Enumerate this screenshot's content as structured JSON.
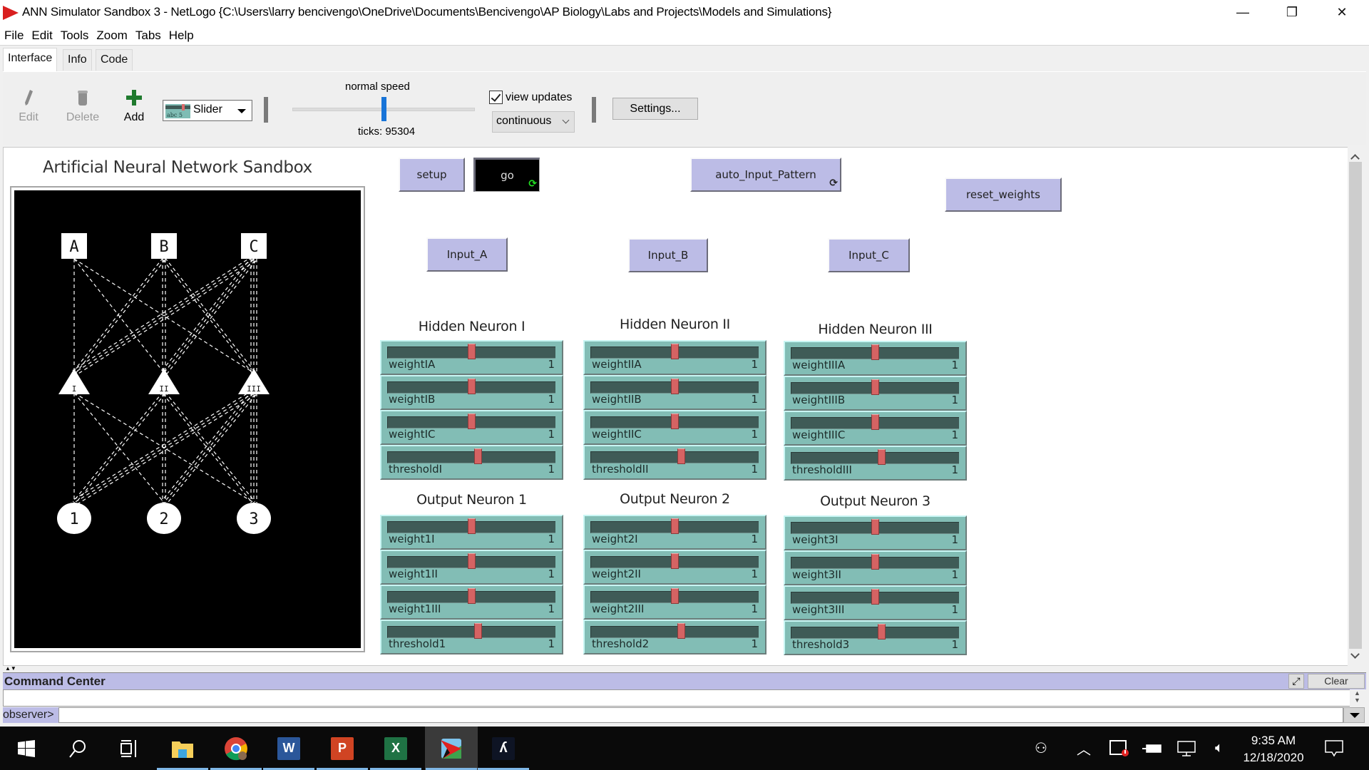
{
  "window": {
    "title": "ANN Simulator Sandbox 3 - NetLogo {C:\\Users\\larry bencivengo\\OneDrive\\Documents\\Bencivengo\\AP Biology\\Labs and Projects\\Models and Simulations}",
    "controls": {
      "minimize": "—",
      "restore": "❐",
      "close": "✕"
    }
  },
  "menu": [
    "File",
    "Edit",
    "Tools",
    "Zoom",
    "Tabs",
    "Help"
  ],
  "tabs": [
    {
      "label": "Interface",
      "active": true
    },
    {
      "label": "Info",
      "active": false
    },
    {
      "label": "Code",
      "active": false
    }
  ],
  "toolbar": {
    "edit_label": "Edit",
    "delete_label": "Delete",
    "add_label": "Add",
    "widget_type": "Slider",
    "speed_label": "normal speed",
    "speed_fraction": 0.5,
    "ticks_label": "ticks: 95304",
    "view_updates_label": "view updates",
    "view_updates_checked": true,
    "update_mode": "continuous",
    "settings_label": "Settings..."
  },
  "interface": {
    "view_title": "Artificial Neural Network Sandbox",
    "network": {
      "inputs": [
        "A",
        "B",
        "C"
      ],
      "hidden": [
        "I",
        "II",
        "III"
      ],
      "outputs": [
        "1",
        "2",
        "3"
      ]
    },
    "buttons": {
      "setup": {
        "label": "setup",
        "forever": false,
        "pressed": false
      },
      "go": {
        "label": "go",
        "forever": true,
        "pressed": true
      },
      "auto_input": {
        "label": "auto_Input_Pattern",
        "forever": true,
        "pressed": false
      },
      "reset_weights": {
        "label": "reset_weights",
        "forever": false,
        "pressed": false
      },
      "input_a": {
        "label": "Input_A"
      },
      "input_b": {
        "label": "Input_B"
      },
      "input_c": {
        "label": "Input_C"
      }
    },
    "slider_groups": [
      {
        "title": "Hidden Neuron I",
        "sliders": [
          {
            "name": "weightIA",
            "value": "1",
            "position": 0.5
          },
          {
            "name": "weightIB",
            "value": "1",
            "position": 0.5
          },
          {
            "name": "weightIC",
            "value": "1",
            "position": 0.5
          },
          {
            "name": "thresholdI",
            "value": "1",
            "position": 0.54
          }
        ]
      },
      {
        "title": "Hidden Neuron II",
        "sliders": [
          {
            "name": "weightIIA",
            "value": "1",
            "position": 0.5
          },
          {
            "name": "weightIIB",
            "value": "1",
            "position": 0.5
          },
          {
            "name": "weightIIC",
            "value": "1",
            "position": 0.5
          },
          {
            "name": "thresholdII",
            "value": "1",
            "position": 0.54
          }
        ]
      },
      {
        "title": "Hidden Neuron III",
        "sliders": [
          {
            "name": "weightIIIA",
            "value": "1",
            "position": 0.5
          },
          {
            "name": "weightIIIB",
            "value": "1",
            "position": 0.5
          },
          {
            "name": "weightIIIC",
            "value": "1",
            "position": 0.5
          },
          {
            "name": "thresholdIII",
            "value": "1",
            "position": 0.54
          }
        ]
      },
      {
        "title": "Output Neuron 1",
        "sliders": [
          {
            "name": "weight1I",
            "value": "1",
            "position": 0.5
          },
          {
            "name": "weight1II",
            "value": "1",
            "position": 0.5
          },
          {
            "name": "weight1III",
            "value": "1",
            "position": 0.5
          },
          {
            "name": "threshold1",
            "value": "1",
            "position": 0.54
          }
        ]
      },
      {
        "title": "Output Neuron 2",
        "sliders": [
          {
            "name": "weight2I",
            "value": "1",
            "position": 0.5
          },
          {
            "name": "weight2II",
            "value": "1",
            "position": 0.5
          },
          {
            "name": "weight2III",
            "value": "1",
            "position": 0.5
          },
          {
            "name": "threshold2",
            "value": "1",
            "position": 0.54
          }
        ]
      },
      {
        "title": "Output Neuron 3",
        "sliders": [
          {
            "name": "weight3I",
            "value": "1",
            "position": 0.5
          },
          {
            "name": "weight3II",
            "value": "1",
            "position": 0.5
          },
          {
            "name": "weight3III",
            "value": "1",
            "position": 0.5
          },
          {
            "name": "threshold3",
            "value": "1",
            "position": 0.54
          }
        ]
      }
    ]
  },
  "command_center": {
    "title": "Command Center",
    "clear_label": "Clear",
    "agent_prompt": "observer>",
    "input_value": ""
  },
  "taskbar": {
    "apps": [
      "start",
      "search",
      "task-view",
      "file-explorer",
      "chrome",
      "word",
      "powerpoint",
      "excel",
      "netlogo",
      "acrobat"
    ],
    "active_app": "netlogo",
    "time": "9:35 AM",
    "date": "12/18/2020"
  },
  "colors": {
    "button_bg": "#bcbce6",
    "slider_bg": "#82bdb5",
    "slider_thumb": "#d56363",
    "title_logo": "#d91f1f"
  }
}
